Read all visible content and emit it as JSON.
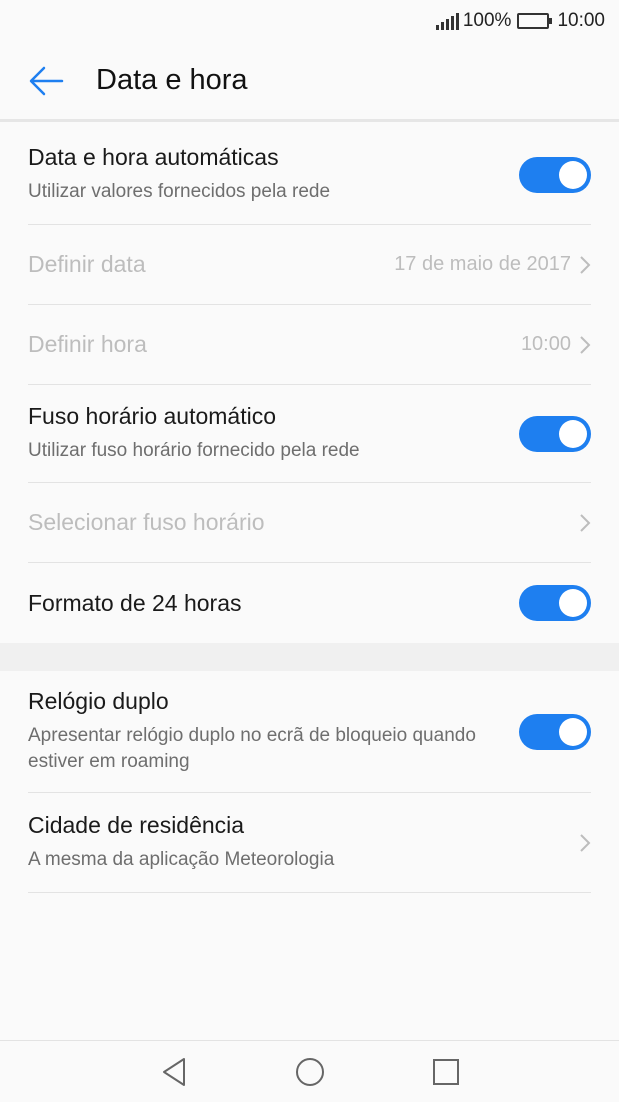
{
  "status_bar": {
    "battery_percent": "100%",
    "time": "10:00"
  },
  "header": {
    "title": "Data e hora",
    "back_icon": "arrow-left-icon"
  },
  "settings": [
    {
      "title": "Data e hora automáticas",
      "subtitle": "Utilizar valores fornecidos pela rede",
      "toggle": true,
      "enabled": true
    },
    {
      "title": "Definir data",
      "value": "17 de maio de 2017",
      "enabled": false
    },
    {
      "title": "Definir hora",
      "value": "10:00",
      "enabled": false
    },
    {
      "title": "Fuso horário automático",
      "subtitle": "Utilizar fuso horário fornecido pela rede",
      "toggle": true,
      "enabled": true
    },
    {
      "title": "Selecionar fuso horário",
      "enabled": false
    },
    {
      "title": "Formato de 24 horas",
      "toggle": true,
      "enabled": true
    },
    {
      "title": "Relógio duplo",
      "subtitle": "Apresentar relógio duplo no ecrã de bloqueio quando estiver em roaming",
      "toggle": true,
      "enabled": true
    },
    {
      "title": "Cidade de residência",
      "subtitle": "A mesma da aplicação Meteorologia",
      "enabled": true
    }
  ],
  "colors": {
    "accent": "#1e7ff0",
    "disabled_text": "#bdbdbd",
    "secondary_text": "#6e6e6e"
  },
  "nav_bar": {
    "icons": [
      "back-triangle-icon",
      "home-circle-icon",
      "recents-square-icon"
    ]
  }
}
